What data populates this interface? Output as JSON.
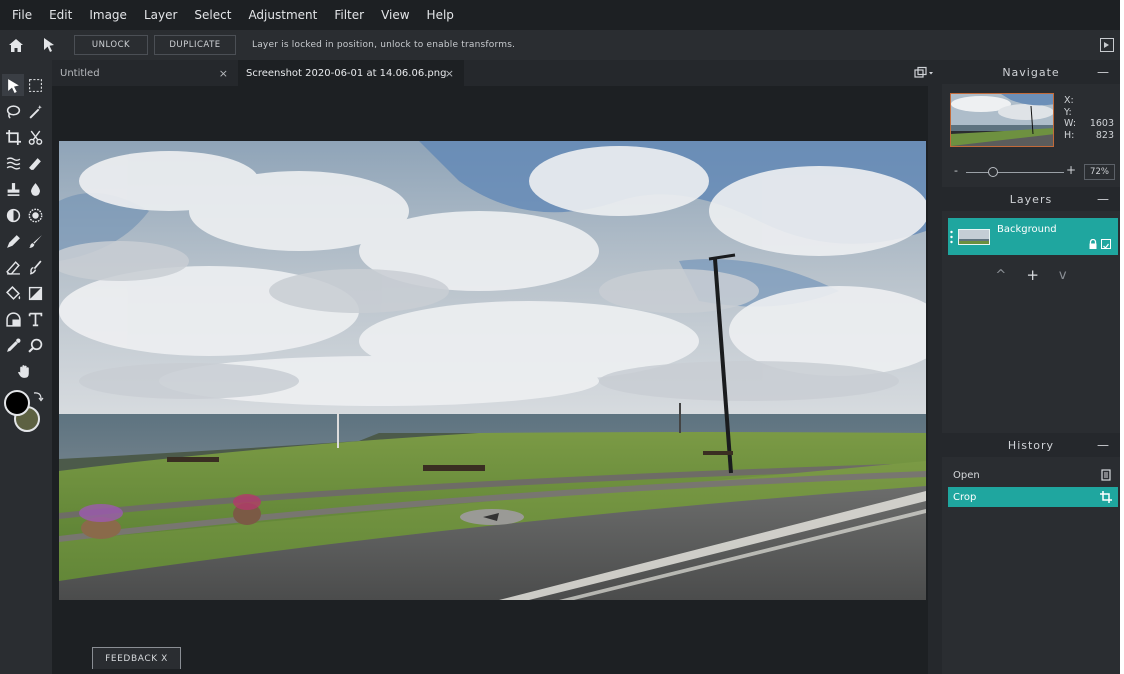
{
  "menu": [
    "File",
    "Edit",
    "Image",
    "Layer",
    "Select",
    "Adjustment",
    "Filter",
    "View",
    "Help"
  ],
  "options": {
    "unlock_label": "UNLOCK",
    "duplicate_label": "DUPLICATE",
    "message": "Layer is locked in position, unlock to enable transforms."
  },
  "tabs": [
    {
      "label": "Untitled",
      "close": "×"
    },
    {
      "label": "Screenshot 2020-06-01 at 14.06.06.png",
      "close": "×"
    }
  ],
  "colors": {
    "foreground": "#000000",
    "background": "#5d6142",
    "accent": "#1fa69f"
  },
  "feedback_label": "FEEDBACK   X",
  "navigate": {
    "title": "Navigate",
    "min": "—",
    "x_label": "X:",
    "x_value": "",
    "y_label": "Y:",
    "y_value": "",
    "w_label": "W:",
    "w_value": "1603",
    "h_label": "H:",
    "h_value": "823",
    "zoom_minus": "-",
    "zoom_plus": "+",
    "zoom": "72%"
  },
  "layers": {
    "title": "Layers",
    "min": "—",
    "items": [
      {
        "name": "Background"
      }
    ],
    "up": "^",
    "add": "+",
    "down": "v"
  },
  "history": {
    "title": "History",
    "min": "—",
    "items": [
      {
        "label": "Open"
      },
      {
        "label": "Crop"
      }
    ]
  },
  "tool_icons": [
    "move-icon",
    "marquee-icon",
    "lasso-icon",
    "magic-wand-icon",
    "crop-icon",
    "scissors-icon",
    "liquify-icon",
    "eraser-icon",
    "stamp-icon",
    "drop-icon",
    "dodge-icon",
    "sponge-icon",
    "pen-icon",
    "brush-icon",
    "eraser-tool-icon",
    "smudge-icon",
    "fill-icon",
    "gradient-icon",
    "shape-icon",
    "type-icon",
    "eyedropper-icon",
    "zoom-icon",
    "hand-icon"
  ]
}
